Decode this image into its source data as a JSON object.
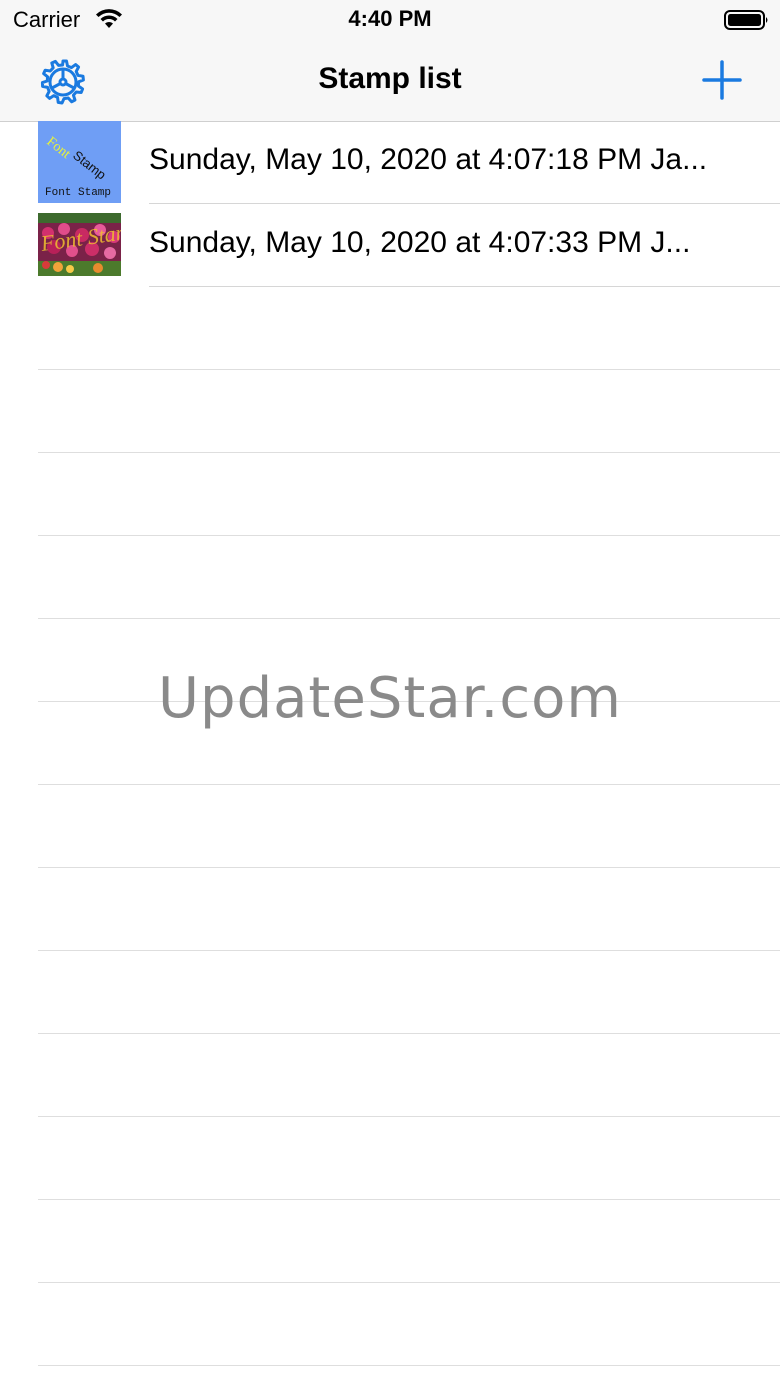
{
  "status_bar": {
    "carrier": "Carrier",
    "time": "4:40 PM",
    "wifi_icon": "wifi-icon",
    "battery_icon": "battery-full-icon"
  },
  "nav": {
    "title": "Stamp list",
    "left_icon": "gear-icon",
    "right_icon": "plus-icon",
    "accent_color": "#1a7ae0"
  },
  "stamps": [
    {
      "text": "Sunday, May 10, 2020 at 4:07:18 PM Ja...",
      "thumb_line1": "Font",
      "thumb_line2": "Stamp",
      "thumb_line3": "Font Stamp"
    },
    {
      "text": "Sunday, May 10, 2020 at 4:07:33 PM J...",
      "thumb_overlay": "Font Stamp"
    }
  ],
  "watermark": "UpdateStar.com"
}
